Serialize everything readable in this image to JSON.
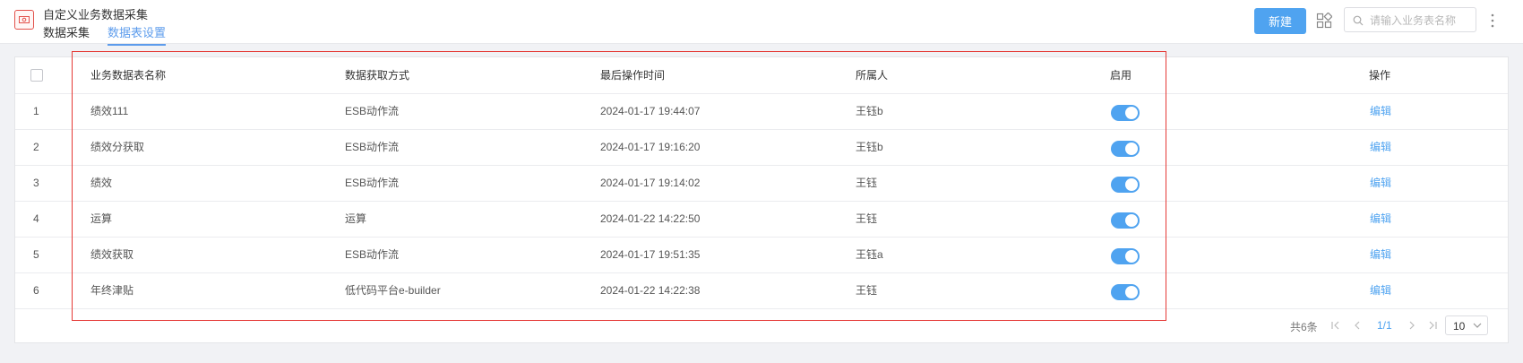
{
  "app": {
    "title": "自定义业务数据采集"
  },
  "tabs": [
    {
      "label": "数据采集",
      "active": false
    },
    {
      "label": "数据表设置",
      "active": true
    }
  ],
  "toolbar": {
    "new_label": "新建",
    "search_placeholder": "请输入业务表名称",
    "accent_color": "#4fa3f0"
  },
  "table": {
    "headers": {
      "name": "业务数据表名称",
      "method": "数据获取方式",
      "time": "最后操作时间",
      "owner": "所属人",
      "enabled": "启用",
      "actions": "操作"
    },
    "rows": [
      {
        "index": "1",
        "name": "绩效111",
        "method": "ESB动作流",
        "time": "2024-01-17 19:44:07",
        "owner": "王钰b",
        "enabled": true,
        "action": "编辑"
      },
      {
        "index": "2",
        "name": "绩效分获取",
        "method": "ESB动作流",
        "time": "2024-01-17 19:16:20",
        "owner": "王钰b",
        "enabled": true,
        "action": "编辑"
      },
      {
        "index": "3",
        "name": "绩效",
        "method": "ESB动作流",
        "time": "2024-01-17 19:14:02",
        "owner": "王钰",
        "enabled": true,
        "action": "编辑"
      },
      {
        "index": "4",
        "name": "运算",
        "method": "运算",
        "time": "2024-01-22 14:22:50",
        "owner": "王钰",
        "enabled": true,
        "action": "编辑"
      },
      {
        "index": "5",
        "name": "绩效获取",
        "method": "ESB动作流",
        "time": "2024-01-17 19:51:35",
        "owner": "王钰a",
        "enabled": true,
        "action": "编辑"
      },
      {
        "index": "6",
        "name": "年终津贴",
        "method": "低代码平台e-builder",
        "time": "2024-01-22 14:22:38",
        "owner": "王钰",
        "enabled": true,
        "action": "编辑"
      }
    ]
  },
  "pagination": {
    "total": "共6条",
    "current": "1/1",
    "page_size": "10"
  }
}
